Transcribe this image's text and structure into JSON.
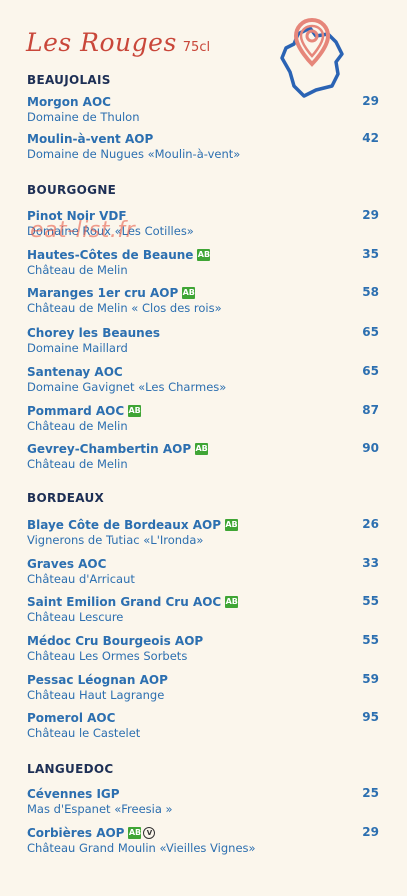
{
  "header": {
    "title": "Les Rouges",
    "volume": "75cl"
  },
  "watermark": "eat-list.fr",
  "sections": [
    {
      "title": "BEAUJOLAIS",
      "wines": [
        {
          "name": "Morgon AOC",
          "domain": "Domaine de Thulon",
          "price": "29"
        },
        {
          "name": "Moulin-à-vent AOP",
          "domain": "Domaine de Nugues «Moulin-à-vent»",
          "price": "42"
        }
      ]
    },
    {
      "title": "BOURGOGNE",
      "wines": [
        {
          "name": "Pinot Noir VDF",
          "domain": "Domaine Roux «Les Cotilles»",
          "price": "29"
        },
        {
          "name": "Hautes-Côtes de Beaune",
          "domain": "Château de Melin",
          "price": "35",
          "bio": true
        },
        {
          "name": "Maranges 1er cru AOP",
          "domain": "Château de Melin « Clos des rois»",
          "price": "58",
          "bio": true
        },
        {
          "name": "Chorey les Beaunes",
          "domain": "Domaine Maillard",
          "price": "65"
        },
        {
          "name": "Santenay AOC",
          "domain": "Domaine Gavignet «Les Charmes»",
          "price": "65"
        },
        {
          "name": "Pommard AOC",
          "domain": "Château de Melin",
          "price": "87",
          "bio": true
        },
        {
          "name": "Gevrey-Chambertin AOP",
          "domain": "Château de Melin",
          "price": "90",
          "bio": true
        }
      ]
    },
    {
      "title": "BORDEAUX",
      "wines": [
        {
          "name": "Blaye Côte de Bordeaux AOP",
          "domain": "Vignerons de Tutiac «L'Ironda»",
          "price": "26",
          "bio": true
        },
        {
          "name": "Graves AOC",
          "domain": "Château d'Arricaut",
          "price": "33"
        },
        {
          "name": "Saint Emilion Grand Cru AOC",
          "domain": "Château Lescure",
          "price": "55",
          "bio": true
        },
        {
          "name": "Médoc Cru Bourgeois AOP",
          "domain": "Château Les Ormes Sorbets",
          "price": "55"
        },
        {
          "name": "Pessac Léognan AOP",
          "domain": "Château Haut Lagrange",
          "price": "59"
        },
        {
          "name": "Pomerol AOC",
          "domain": "Château le Castelet",
          "price": "95"
        }
      ]
    },
    {
      "title": "LANGUEDOC",
      "wines": [
        {
          "name": "Cévennes IGP",
          "domain": "Mas d'Espanet «Freesia »",
          "price": "25"
        },
        {
          "name": "Corbières AOP",
          "domain": "Château Grand Moulin «Vieilles Vignes»",
          "price": "29",
          "bio": true,
          "vegan": true
        }
      ]
    }
  ],
  "colors": {
    "title": "#c9473a",
    "section": "#1d2f55",
    "wine": "#2c6fb0",
    "bio": "#3fa535",
    "background": "#fbf6ec"
  },
  "icons": {
    "bio": "ab-organic-icon",
    "vegan": "vegan-icon",
    "map": "france-map-pin-icon"
  }
}
